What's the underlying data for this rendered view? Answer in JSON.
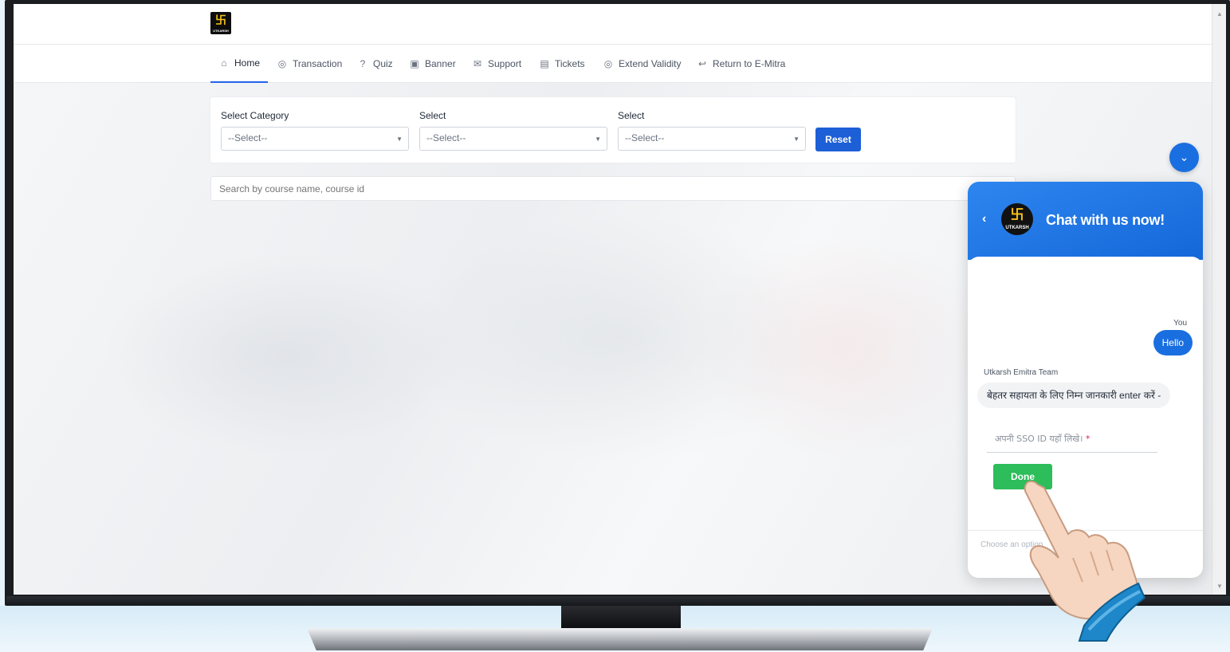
{
  "brand": {
    "logo_glyph": "卐",
    "logo_text": "UTKARSH"
  },
  "nav": {
    "items": [
      {
        "label": "Home",
        "icon": "home-icon",
        "glyph": "⌂"
      },
      {
        "label": "Transaction",
        "icon": "transaction-icon",
        "glyph": "◎"
      },
      {
        "label": "Quiz",
        "icon": "help-circle-icon",
        "glyph": "?"
      },
      {
        "label": "Banner",
        "icon": "image-icon",
        "glyph": "▣"
      },
      {
        "label": "Support",
        "icon": "mail-icon",
        "glyph": "✉"
      },
      {
        "label": "Tickets",
        "icon": "ticket-icon",
        "glyph": "▤"
      },
      {
        "label": "Extend Validity",
        "icon": "extend-icon",
        "glyph": "◎"
      },
      {
        "label": "Return to E-Mitra",
        "icon": "return-icon",
        "glyph": "↩"
      }
    ]
  },
  "filters": {
    "category_label": "Select Category",
    "select2_label": "Select",
    "select3_label": "Select",
    "placeholder": "--Select--",
    "reset_label": "Reset"
  },
  "search": {
    "placeholder": "Search by course name, course id"
  },
  "chat": {
    "title": "Chat with us now!",
    "you_label": "You",
    "you_message": "Hello",
    "agent_label": "Utkarsh Emitra Team",
    "agent_message": "बेहतर सहायता के लिए निम्न जानकारी enter करें -",
    "sso_placeholder": "अपनी SSO ID यहाँ लिखे।",
    "required_mark": "*",
    "done_label": "Done",
    "footer_placeholder": "Choose an option"
  },
  "colors": {
    "accent": "#1d5fd6",
    "chat_header": "#1a6fe0",
    "done": "#2dbd5a"
  }
}
